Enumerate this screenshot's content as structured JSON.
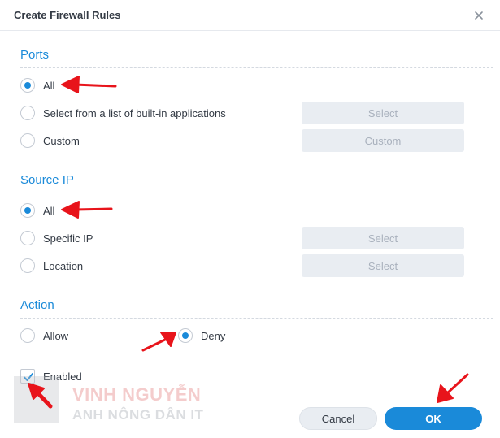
{
  "dialog": {
    "title": "Create Firewall Rules"
  },
  "ports": {
    "title": "Ports",
    "options": [
      {
        "label": "All",
        "checked": true
      },
      {
        "label": "Select from a list of built-in applications",
        "checked": false,
        "button": "Select"
      },
      {
        "label": "Custom",
        "checked": false,
        "button": "Custom"
      }
    ]
  },
  "source_ip": {
    "title": "Source IP",
    "options": [
      {
        "label": "All",
        "checked": true
      },
      {
        "label": "Specific IP",
        "checked": false,
        "button": "Select"
      },
      {
        "label": "Location",
        "checked": false,
        "button": "Select"
      }
    ]
  },
  "action": {
    "title": "Action",
    "options": [
      {
        "label": "Allow",
        "checked": false
      },
      {
        "label": "Deny",
        "checked": true
      }
    ]
  },
  "enabled": {
    "label": "Enabled",
    "checked": true
  },
  "footer": {
    "cancel_label": "Cancel",
    "ok_label": "OK"
  },
  "watermark": {
    "line1": "VINH NGUYỄN",
    "line2": "ANH NÔNG DÂN IT"
  },
  "colors": {
    "accent": "#1a8ad9",
    "annotation_arrow": "#e8141b"
  },
  "icons": {
    "close": "close-icon",
    "check": "checkmark-icon",
    "annotation": "red-arrow-icon"
  }
}
